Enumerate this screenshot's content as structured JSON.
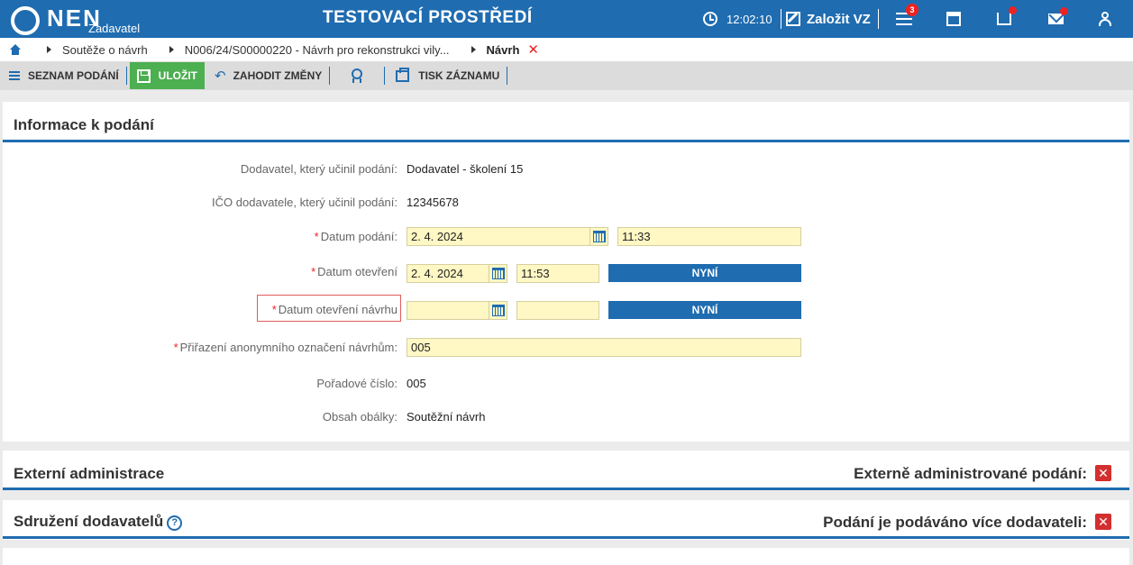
{
  "header": {
    "logo": "NEN",
    "logo_sub": "Zadavatel",
    "env_title": "TESTOVACÍ PROSTŘEDÍ",
    "clock": "12:02:10",
    "new_vz": "Založit VZ",
    "menu_badge": "3"
  },
  "breadcrumb": {
    "items": [
      "Soutěže o návrh",
      "N006/24/S00000220 - Návrh pro rekonstrukci vily...",
      "Návrh"
    ],
    "close": "✕"
  },
  "toolbar": {
    "list": "SEZNAM PODÁNÍ",
    "save": "ULOŽIT",
    "discard": "ZAHODIT ZMĚNY",
    "print": "TISK ZÁZNAMU"
  },
  "info": {
    "title": "Informace k podání",
    "supplier_label": "Dodavatel, který učinil podání:",
    "supplier_value": "Dodavatel - školení 15",
    "ico_label": "IČO dodavatele, který učinil podání:",
    "ico_value": "12345678",
    "submit_date_label": "Datum podání:",
    "submit_date": "2. 4. 2024",
    "submit_time": "11:33",
    "open_date_label": "Datum otevření",
    "open_date": "2. 4. 2024",
    "open_time": "11:53",
    "now_label": "NYNÍ",
    "design_open_label": "Datum otevření návrhu",
    "design_open_date": "",
    "design_open_time": "",
    "anon_label": "Přiřazení anonymního označení návrhům:",
    "anon_value": "005",
    "order_label": "Pořadové číslo:",
    "order_value": "005",
    "envelope_label": "Obsah obálky:",
    "envelope_value": "Soutěžní návrh"
  },
  "external": {
    "title": "Externí administrace",
    "right_label": "Externě administrované podání:",
    "mark": "✕"
  },
  "association": {
    "title": "Sdružení dodavatelů",
    "help": "?",
    "right_label": "Podání je podáváno více dodavateli:",
    "mark": "✕"
  },
  "colors": {
    "primary": "#1f6cb0",
    "save_green": "#4caf50",
    "field_yellow": "#fff7c4",
    "danger": "#d32f2f"
  }
}
